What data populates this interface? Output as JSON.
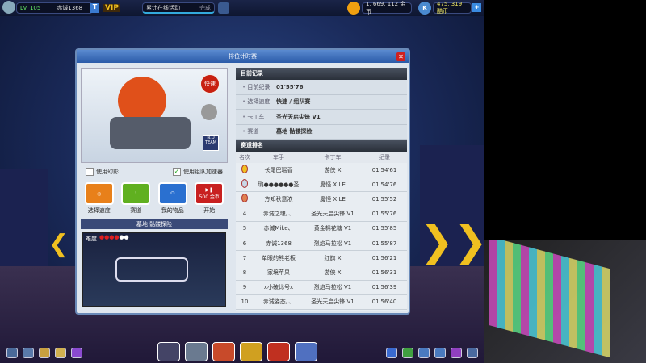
{
  "topbar": {
    "level": "Lv. 105",
    "player_name": "赤诚1368",
    "vip": "VIP",
    "event_label": "累计在线活动",
    "event_status": "完成",
    "gold": "1, 669, 112 金币",
    "kcoin": "475, 319 酷币"
  },
  "dialog": {
    "title": "排位计时赛",
    "fast_button": "快速",
    "team_badge": "N.O TEAM",
    "option_shadow": "使用幻影",
    "option_team_boost": "使用组队加速器",
    "actions": [
      {
        "label": "选择速度"
      },
      {
        "label": "赛道"
      },
      {
        "label": "我的物品"
      },
      {
        "label": "开始",
        "cost": "500 金币"
      }
    ],
    "track_name": "墓地 骷髅探险",
    "difficulty_label": "难度",
    "difficulty": {
      "value": 4,
      "max": 6
    },
    "current_record": {
      "header": "目前记录",
      "rows": [
        {
          "key": "目前纪录",
          "value": "01'55'76"
        },
        {
          "key": "选择速度",
          "value": "快速 / 组队赛"
        },
        {
          "key": "卡丁车",
          "value": "圣光天启尖锋 V1"
        },
        {
          "key": "赛道",
          "value": "墓地 骷髅探险"
        }
      ]
    },
    "ranking": {
      "header": "赛道排名",
      "columns": [
        "名次",
        "车手",
        "卡丁车",
        "纪录"
      ],
      "rows": [
        {
          "rank": "",
          "medal": "gold",
          "driver": "长尾巴瑶香",
          "kart": "游侠 X",
          "time": "01'54'61"
        },
        {
          "rank": "",
          "medal": "silver",
          "driver": "璐●●●●●●圣",
          "kart": "魔怪 X LE",
          "time": "01'54'76"
        },
        {
          "rank": "",
          "medal": "bronze",
          "driver": "方知秋意浓",
          "kart": "魔怪 X LE",
          "time": "01'55'52"
        },
        {
          "rank": "4",
          "driver": "赤诚之魂｡、",
          "kart": "圣光天启尖锋 V1",
          "time": "01'55'76"
        },
        {
          "rank": "5",
          "driver": "赤诚Mike、",
          "kart": "黄金棉花糖 V1",
          "time": "01'55'85"
        },
        {
          "rank": "6",
          "driver": "赤诚1368",
          "kart": "烈焰马拉松 V1",
          "time": "01'55'87"
        },
        {
          "rank": "7",
          "driver": "单眼的熊老板",
          "kart": "红旗 X",
          "time": "01'56'21"
        },
        {
          "rank": "8",
          "driver": "家境苹果",
          "kart": "游侠 X",
          "time": "01'56'31"
        },
        {
          "rank": "9",
          "driver": "x小破比号x",
          "kart": "烈焰马拉松 V1",
          "time": "01'56'39"
        },
        {
          "rank": "10",
          "driver": "赤诚姿态｡、",
          "kart": "圣光天启尖锋 V1",
          "time": "01'56'40"
        }
      ]
    }
  }
}
